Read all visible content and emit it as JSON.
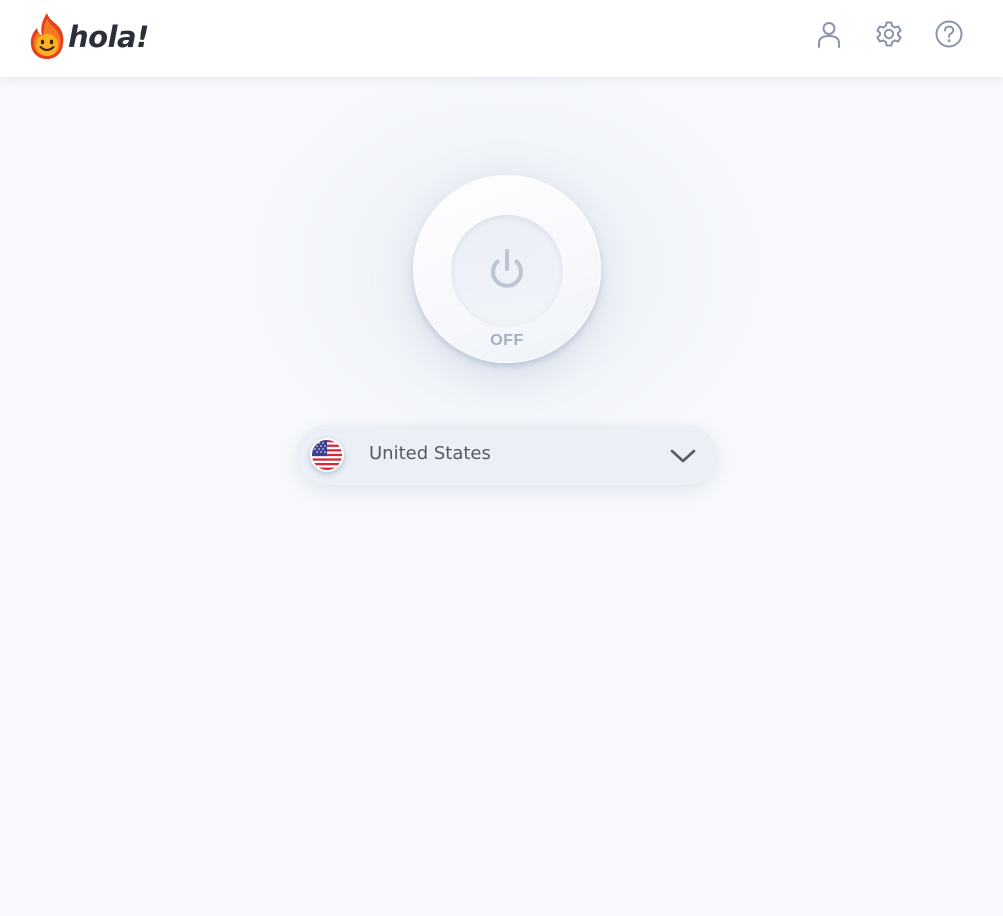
{
  "app": {
    "name": "hola!"
  },
  "header": {
    "logo_text": "hola!",
    "icons": {
      "account": "account-icon",
      "settings": "gear-icon",
      "help": "help-icon"
    }
  },
  "power": {
    "status": "OFF",
    "icon": "power-icon"
  },
  "country_selector": {
    "selected": "United States",
    "flag": "us-flag-icon",
    "icon": "chevron-down-icon"
  },
  "colors": {
    "accent_flame": "#f05a24",
    "text_dark": "#2b2f3a",
    "icon_gray": "#8a95aa",
    "status_gray": "#a4afc1"
  }
}
